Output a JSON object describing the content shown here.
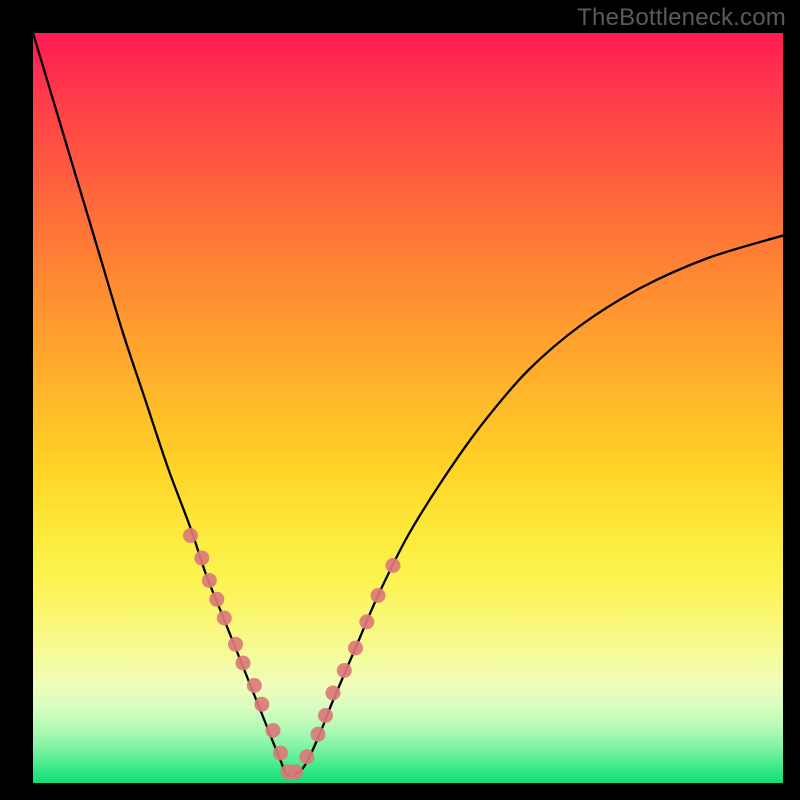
{
  "watermark": "TheBottleneck.com",
  "colors": {
    "frame": "#000000",
    "curve": "#000000",
    "marker": "#db7a7a",
    "gradient_top": "#ff1a53",
    "gradient_bottom": "#0ede73"
  },
  "chart_data": {
    "type": "line",
    "title": "",
    "xlabel": "",
    "ylabel": "",
    "xlim": [
      0,
      100
    ],
    "ylim": [
      0,
      100
    ],
    "grid": false,
    "legend": false,
    "note": "Axes unlabeled; values are percent of plot area (0=left/bottom, 100=right/top). Higher y = worse (red), y≈0 = best (green). Curve is V-shaped with minimum near x≈34.",
    "series": [
      {
        "name": "bottleneck-curve",
        "x": [
          0,
          3,
          6,
          9,
          12,
          15,
          18,
          21,
          23,
          25,
          27,
          29,
          31,
          33,
          34,
          36,
          38,
          40,
          43,
          46,
          50,
          55,
          60,
          66,
          73,
          81,
          90,
          100
        ],
        "y": [
          100,
          90,
          80,
          70,
          60,
          51,
          42,
          34,
          28,
          23,
          18,
          13,
          8,
          3,
          1,
          2,
          6,
          11,
          18,
          25,
          33,
          41,
          48,
          55,
          61,
          66,
          70,
          73
        ]
      }
    ],
    "markers": {
      "name": "highlighted-points",
      "note": "Scattered salmon dots clustered along the curve near the bottom of the V.",
      "x": [
        21,
        22.5,
        23.5,
        24.5,
        25.5,
        27,
        28,
        29.5,
        30.5,
        32,
        33,
        34,
        35,
        36.5,
        38,
        39,
        40,
        41.5,
        43,
        44.5,
        46,
        48
      ],
      "y": [
        33,
        30,
        27,
        24.5,
        22,
        18.5,
        16,
        13,
        10.5,
        7,
        4,
        1.5,
        1.5,
        3.5,
        6.5,
        9,
        12,
        15,
        18,
        21.5,
        25,
        29
      ]
    }
  }
}
